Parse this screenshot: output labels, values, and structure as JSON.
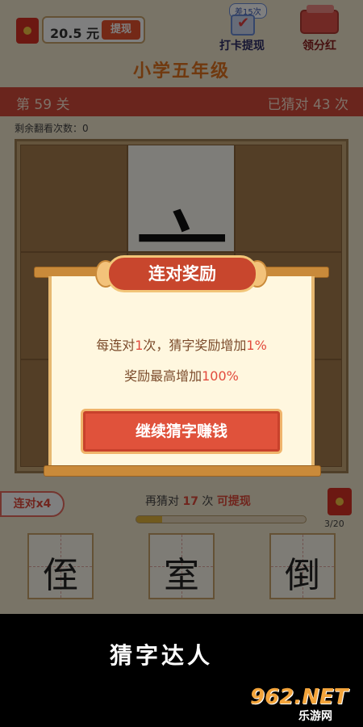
{
  "topbar": {
    "balance": "20.5 元",
    "withdraw_label": "提现",
    "checkin_badge": "差15次",
    "checkin_label": "打卡提现",
    "dividend_label": "领分红"
  },
  "grade_title": "小学五年级",
  "level_bar": {
    "level": "第 59 关",
    "guessed": "已猜对 43 次"
  },
  "remaining_flips": "剩余翻看次数：0",
  "board": {
    "revealed_char": "六"
  },
  "streak_badge": "连对x4",
  "progress": {
    "prefix": "再猜对",
    "count": "17",
    "unit": "次",
    "suffix": "可提现",
    "fraction_label": "3/20",
    "fill_fraction": 0.15
  },
  "choices": [
    "侄",
    "室",
    "倒"
  ],
  "modal": {
    "title": "连对奖励",
    "line1_a": "每连对",
    "line1_b": "1",
    "line1_c": "次，猜字奖励增加",
    "line1_d": "1%",
    "line2_a": "奖励最高增加",
    "line2_b": "100%",
    "button": "继续猜字赚钱"
  },
  "caption": "猜字达人",
  "watermark": {
    "main": "962.NET",
    "sub": "乐游网"
  },
  "colors": {
    "accent_red": "#d44b3a",
    "highlight": "#e24b3d",
    "title_orange": "#e0731f"
  }
}
